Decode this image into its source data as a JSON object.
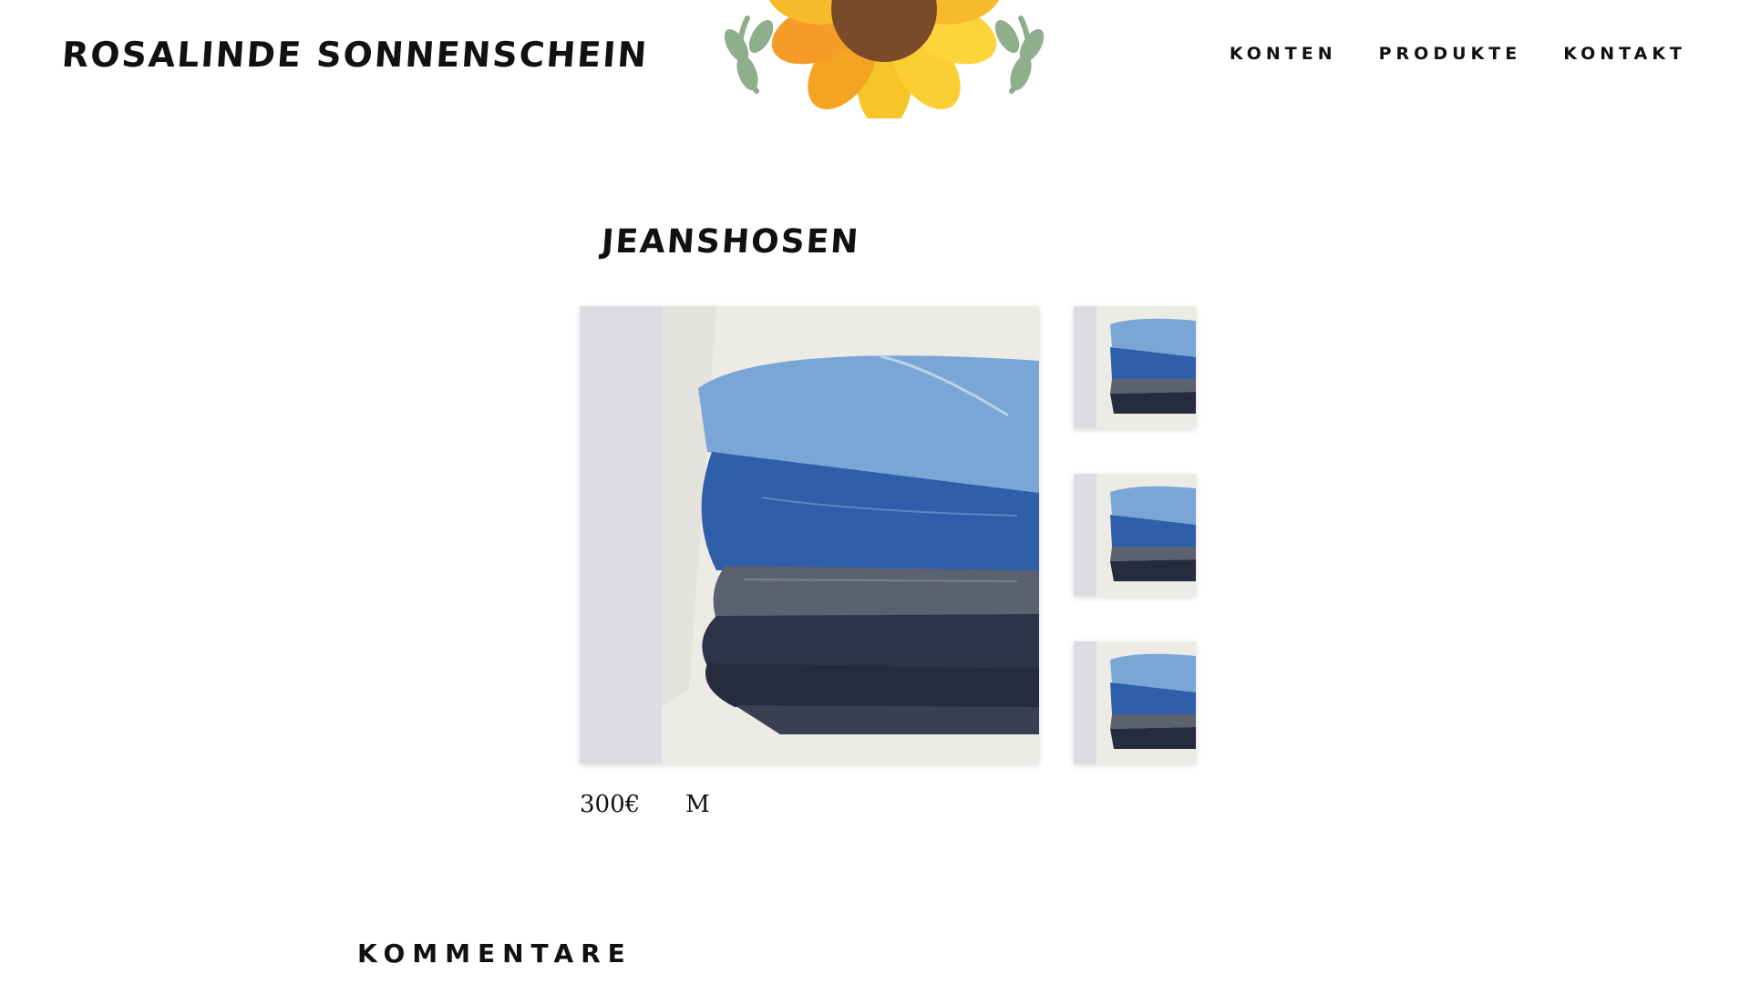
{
  "header": {
    "brand": "ROSALINDE SONNENSCHEIN",
    "logo_icon": "sunflower-icon",
    "nav": [
      {
        "label": "KONTEN"
      },
      {
        "label": "PRODUKTE"
      },
      {
        "label": "KONTAKT"
      }
    ]
  },
  "product": {
    "title": "JEANSHOSEN",
    "price": "300€",
    "size": "M",
    "image_icon": "folded-jeans-photo",
    "thumbnail_count": 3
  },
  "comments": {
    "heading": "KOMMENTARE"
  },
  "colors": {
    "text": "#111111",
    "background": "#ffffff",
    "sunflower_petal": "#f7b51f",
    "sunflower_center": "#7a4a2a",
    "leaf": "#8fae8c",
    "denim_light": "#6f9fd0",
    "denim_mid": "#2f5fa8",
    "denim_dark": "#2a2f45"
  }
}
